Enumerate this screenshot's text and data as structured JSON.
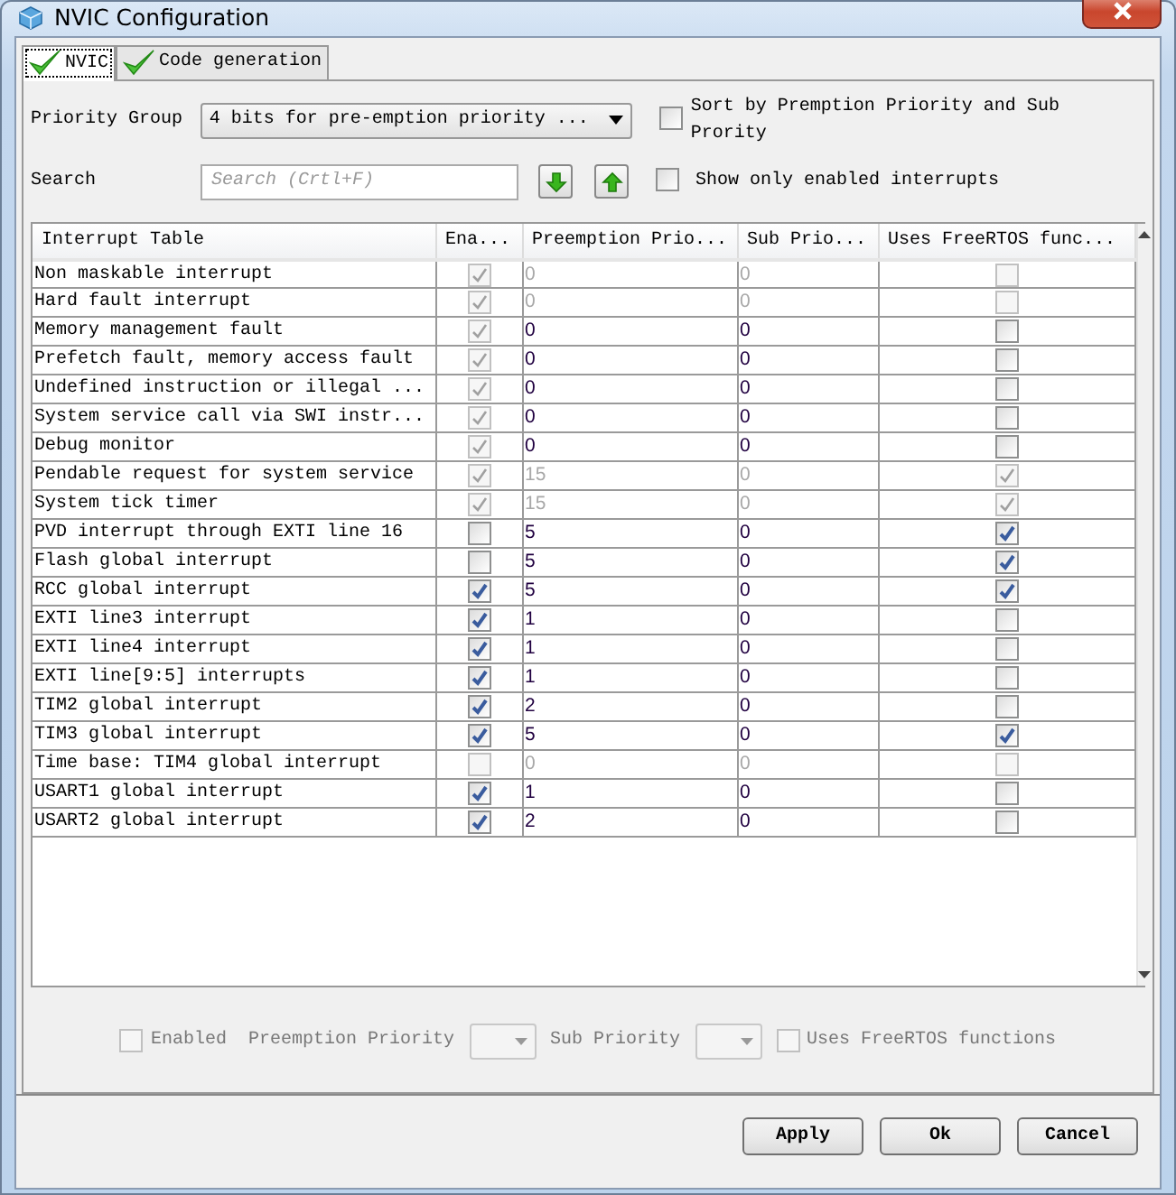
{
  "window": {
    "title": "NVIC Configuration"
  },
  "tabs": [
    {
      "label": "NVIC",
      "selected": true
    },
    {
      "label": "Code generation",
      "selected": false
    }
  ],
  "priority_group": {
    "label": "Priority Group",
    "value": "4 bits for pre-emption priority ..."
  },
  "sort_option": {
    "label": "Sort by Premption Priority and Sub Prority",
    "checked": false
  },
  "search": {
    "label": "Search",
    "placeholder": "Search (Crtl+F)"
  },
  "show_enabled_option": {
    "label": "Show only enabled interrupts",
    "checked": false
  },
  "table": {
    "columns": [
      "Interrupt Table",
      "Ena...",
      "Preemption Prio...",
      "Sub Prio...",
      "Uses FreeRTOS func..."
    ],
    "rows": [
      {
        "name": "Non maskable interrupt",
        "enabled": true,
        "enabled_locked": true,
        "preemption": "0",
        "sub": "0",
        "priority_locked": true,
        "freertos": false,
        "freertos_locked": true
      },
      {
        "name": "Hard fault interrupt",
        "enabled": true,
        "enabled_locked": true,
        "preemption": "0",
        "sub": "0",
        "priority_locked": true,
        "freertos": false,
        "freertos_locked": true
      },
      {
        "name": "Memory management fault",
        "enabled": true,
        "enabled_locked": true,
        "preemption": "0",
        "sub": "0",
        "priority_locked": false,
        "freertos": false,
        "freertos_locked": false
      },
      {
        "name": "Prefetch fault, memory access fault",
        "enabled": true,
        "enabled_locked": true,
        "preemption": "0",
        "sub": "0",
        "priority_locked": false,
        "freertos": false,
        "freertos_locked": false
      },
      {
        "name": "Undefined instruction or illegal ...",
        "enabled": true,
        "enabled_locked": true,
        "preemption": "0",
        "sub": "0",
        "priority_locked": false,
        "freertos": false,
        "freertos_locked": false
      },
      {
        "name": "System service call via SWI instr...",
        "enabled": true,
        "enabled_locked": true,
        "preemption": "0",
        "sub": "0",
        "priority_locked": false,
        "freertos": false,
        "freertos_locked": false
      },
      {
        "name": "Debug monitor",
        "enabled": true,
        "enabled_locked": true,
        "preemption": "0",
        "sub": "0",
        "priority_locked": false,
        "freertos": false,
        "freertos_locked": false
      },
      {
        "name": "Pendable request for system service",
        "enabled": true,
        "enabled_locked": true,
        "preemption": "15",
        "sub": "0",
        "priority_locked": true,
        "freertos": true,
        "freertos_locked": true
      },
      {
        "name": "System tick timer",
        "enabled": true,
        "enabled_locked": true,
        "preemption": "15",
        "sub": "0",
        "priority_locked": true,
        "freertos": true,
        "freertos_locked": true
      },
      {
        "name": "PVD interrupt through EXTI line 16",
        "enabled": false,
        "enabled_locked": false,
        "preemption": "5",
        "sub": "0",
        "priority_locked": false,
        "freertos": true,
        "freertos_locked": false
      },
      {
        "name": "Flash global interrupt",
        "enabled": false,
        "enabled_locked": false,
        "preemption": "5",
        "sub": "0",
        "priority_locked": false,
        "freertos": true,
        "freertos_locked": false
      },
      {
        "name": "RCC global interrupt",
        "enabled": true,
        "enabled_locked": false,
        "preemption": "5",
        "sub": "0",
        "priority_locked": false,
        "freertos": true,
        "freertos_locked": false
      },
      {
        "name": "EXTI line3 interrupt",
        "enabled": true,
        "enabled_locked": false,
        "preemption": "1",
        "sub": "0",
        "priority_locked": false,
        "freertos": false,
        "freertos_locked": false
      },
      {
        "name": "EXTI line4 interrupt",
        "enabled": true,
        "enabled_locked": false,
        "preemption": "1",
        "sub": "0",
        "priority_locked": false,
        "freertos": false,
        "freertos_locked": false
      },
      {
        "name": "EXTI line[9:5] interrupts",
        "enabled": true,
        "enabled_locked": false,
        "preemption": "1",
        "sub": "0",
        "priority_locked": false,
        "freertos": false,
        "freertos_locked": false
      },
      {
        "name": "TIM2 global interrupt",
        "enabled": true,
        "enabled_locked": false,
        "preemption": "2",
        "sub": "0",
        "priority_locked": false,
        "freertos": false,
        "freertos_locked": false
      },
      {
        "name": "TIM3 global interrupt",
        "enabled": true,
        "enabled_locked": false,
        "preemption": "5",
        "sub": "0",
        "priority_locked": false,
        "freertos": true,
        "freertos_locked": false
      },
      {
        "name": "Time base: TIM4 global interrupt",
        "enabled": false,
        "enabled_locked": true,
        "preemption": "0",
        "sub": "0",
        "priority_locked": true,
        "freertos": false,
        "freertos_locked": true
      },
      {
        "name": "USART1 global interrupt",
        "enabled": true,
        "enabled_locked": false,
        "preemption": "1",
        "sub": "0",
        "priority_locked": false,
        "freertos": false,
        "freertos_locked": false
      },
      {
        "name": "USART2 global interrupt",
        "enabled": true,
        "enabled_locked": false,
        "preemption": "2",
        "sub": "0",
        "priority_locked": false,
        "freertos": false,
        "freertos_locked": false
      }
    ]
  },
  "detail": {
    "enabled_label": "Enabled",
    "enabled_checked": false,
    "preemption_label": "Preemption Priority",
    "sub_label": "Sub Priority",
    "freertos_label": "Uses FreeRTOS functions",
    "freertos_checked": false,
    "disabled": true
  },
  "buttons": [
    "Apply",
    "Ok",
    "Cancel"
  ]
}
